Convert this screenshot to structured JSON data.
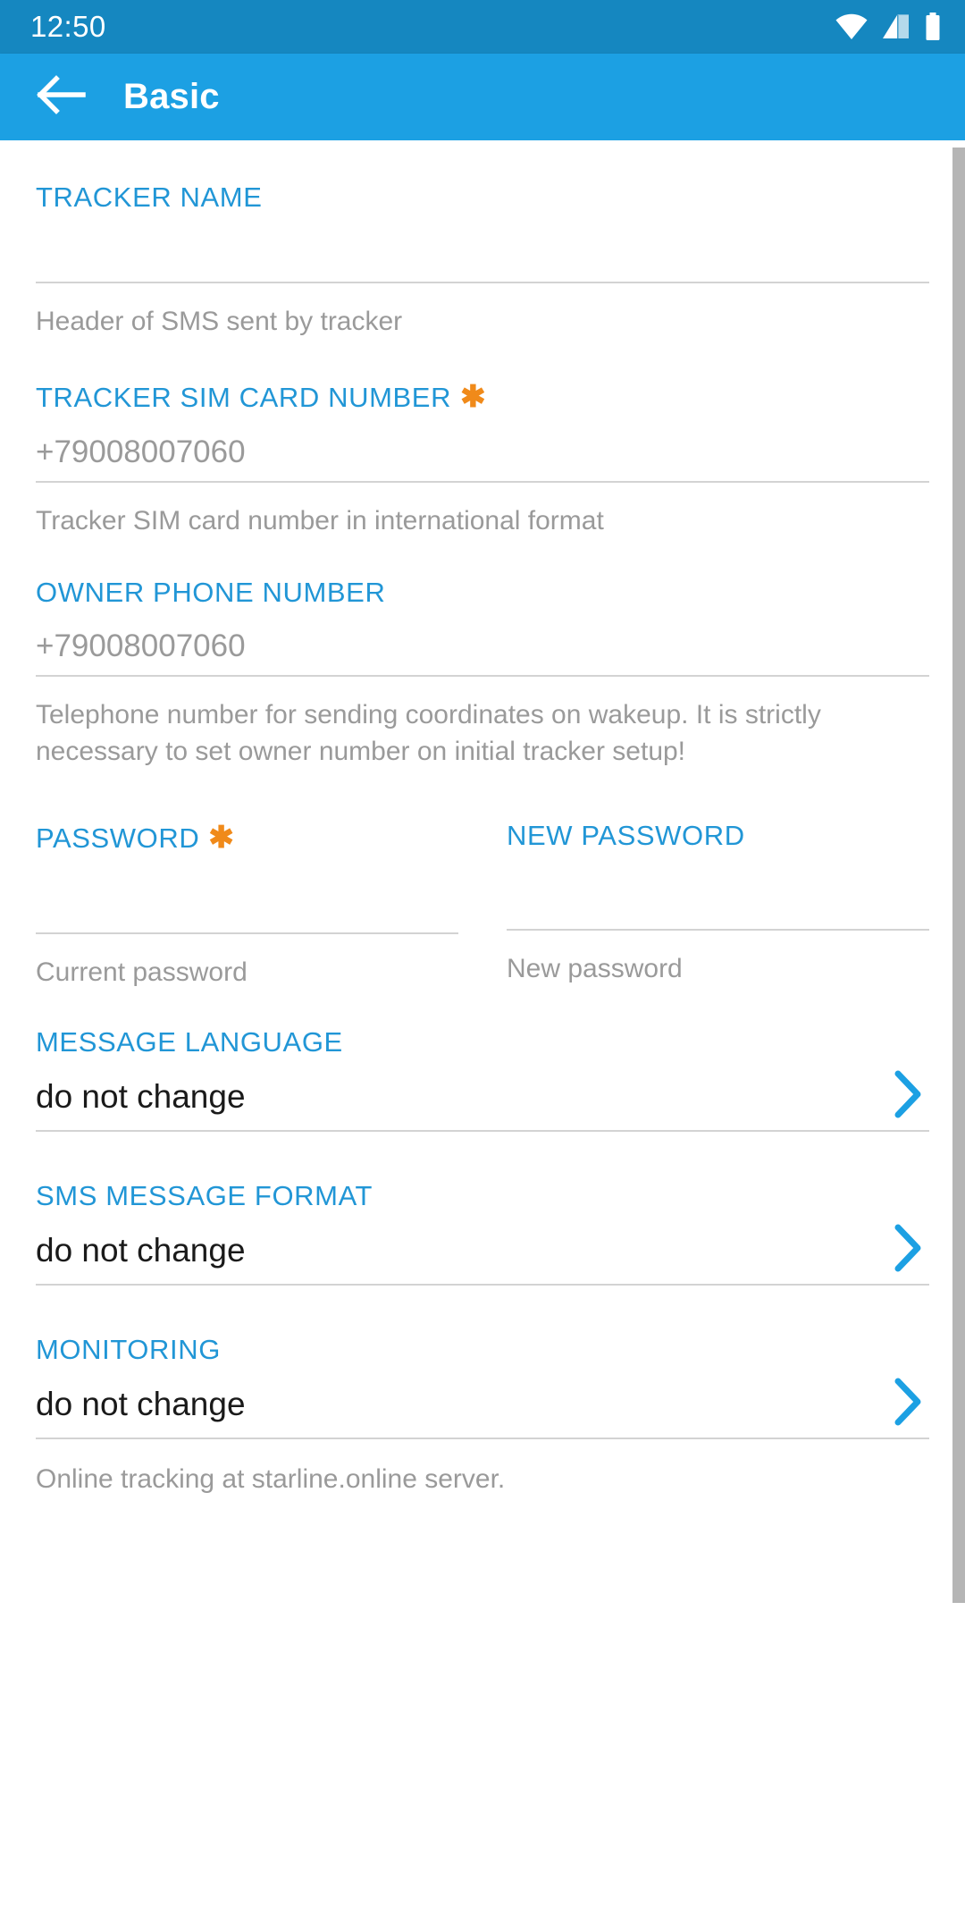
{
  "status_bar": {
    "time": "12:50",
    "icons": [
      "wifi-icon",
      "cellular-signal-icon",
      "battery-icon"
    ],
    "background": "#1587c0"
  },
  "app_bar": {
    "back_label": "back-arrow",
    "title": "Basic",
    "background": "#1ca0e3"
  },
  "colors": {
    "accent": "#2196d6",
    "required_marker": "#f08a1a",
    "helper_text": "#9a9a9a",
    "value_text": "#1a1a1a",
    "divider": "#d3d3d3"
  },
  "form": {
    "tracker_name": {
      "label": "TRACKER NAME",
      "value": "",
      "placeholder": "",
      "helper": "Header of SMS sent by tracker",
      "required": false
    },
    "tracker_sim": {
      "label": "TRACKER SIM CARD NUMBER",
      "required_marker": "✱",
      "value": "+79008007060",
      "helper": "Tracker SIM card number in international format",
      "required": true
    },
    "owner_phone": {
      "label": "OWNER PHONE NUMBER",
      "value": "+79008007060",
      "helper": "Telephone number for sending coordinates on wakeup. It is strictly necessary to set owner number on initial tracker setup!",
      "required": false
    },
    "password": {
      "label": "PASSWORD",
      "required_marker": "✱",
      "value": "",
      "helper": "Current password",
      "required": true
    },
    "new_password": {
      "label": "NEW PASSWORD",
      "value": "",
      "helper": "New password",
      "required": false
    },
    "message_language": {
      "label": "MESSAGE LANGUAGE",
      "value": "do not change",
      "chevron": "chevron-right-icon"
    },
    "sms_message_format": {
      "label": "SMS MESSAGE FORMAT",
      "value": "do not change",
      "chevron": "chevron-right-icon"
    },
    "monitoring": {
      "label": "MONITORING",
      "value": "do not change",
      "helper": "Online tracking at starline.online server.",
      "chevron": "chevron-right-icon"
    }
  }
}
